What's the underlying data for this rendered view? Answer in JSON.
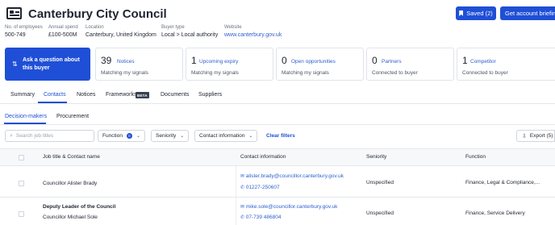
{
  "header": {
    "title": "Canterbury City Council",
    "saved_label": "Saved (2)",
    "briefing_label": "Get account briefing"
  },
  "meta": [
    {
      "label": "No. of employees",
      "value": "500-749"
    },
    {
      "label": "Annual spend",
      "value": "£100-500M"
    },
    {
      "label": "Location",
      "value": "Canterbury, United Kingdom"
    },
    {
      "label": "Buyer type",
      "value": "Local > Local authority"
    },
    {
      "label": "Website",
      "value": "www.canterbury.gov.uk"
    }
  ],
  "ask": {
    "label": "Ask a question about this buyer"
  },
  "stats": [
    {
      "number": "39",
      "label": "Notices",
      "sub": "Matching my signals"
    },
    {
      "number": "1",
      "label": "Upcoming expiry",
      "sub": "Matching my signals"
    },
    {
      "number": "0",
      "label": "Open opportunities",
      "sub": "Matching my signals"
    },
    {
      "number": "0",
      "label": "Partners",
      "sub": "Connected to buyer"
    },
    {
      "number": "1",
      "label": "Competitor",
      "sub": "Connected to buyer"
    }
  ],
  "tabs": [
    "Summary",
    "Contacts",
    "Notices",
    "Frameworks",
    "Documents",
    "Suppliers"
  ],
  "beta_label": "BETA",
  "subtabs": [
    "Decision-makers",
    "Procurement"
  ],
  "filters": {
    "search_placeholder": "Search job titles",
    "function_label": "Function",
    "function_count": "0",
    "seniority_label": "Seniority",
    "contact_label": "Contact information",
    "clear_label": "Clear filters",
    "export_label": "Export (5)"
  },
  "table": {
    "headers": [
      "Job title & Contact name",
      "Contact information",
      "Seniority",
      "Function"
    ],
    "rows": [
      {
        "title": "",
        "name": "Councillor Alister Brady",
        "email": "alister.brady@councillor.canterbury.gov.uk",
        "phone": "01227-250607",
        "seniority": "Unspecified",
        "function": "Finance, Legal & Compliance,..."
      },
      {
        "title": "Deputy Leader of the Council",
        "name": "Councillor Michael Sole",
        "email": "mike.sole@councillor.canterbury.gov.uk",
        "phone": "07-739 486804",
        "seniority": "Unspecified",
        "function": "Finance, Service Delivery"
      }
    ]
  },
  "colors": {
    "accent": "#1f4fd6",
    "link": "#2f5fd0"
  },
  "icons": [
    "buyer-card-icon",
    "bookmark-icon",
    "arrows-icon",
    "search-icon",
    "chevron-down-icon",
    "export-icon",
    "mail-icon",
    "phone-icon"
  ]
}
